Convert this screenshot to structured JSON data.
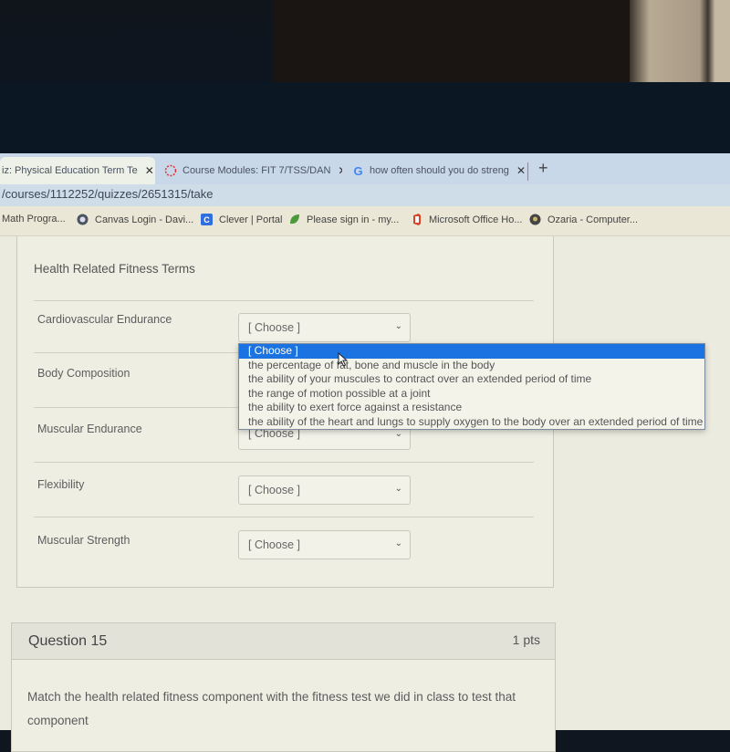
{
  "browser": {
    "tabs": [
      {
        "title": "iz: Physical Education Term Te",
        "icon": "canvas-quiz-icon",
        "active": true
      },
      {
        "title": "Course Modules: FIT 7/TSS/DAN",
        "icon": "canvas-logo-icon",
        "active": false
      },
      {
        "title": "how often should you do streng",
        "icon": "google-icon",
        "active": false
      }
    ],
    "close_glyph": "✕",
    "new_tab_glyph": "+",
    "url": "/courses/1112252/quizzes/2651315/take",
    "bookmarks": [
      {
        "label": "Math Progra...",
        "icon": "none"
      },
      {
        "label": "Canvas Login - Davi...",
        "icon": "canvas-icon"
      },
      {
        "label": "Clever | Portal",
        "icon": "clever-icon",
        "icon_text": "C"
      },
      {
        "label": "Please sign in - my...",
        "icon": "leaf-icon"
      },
      {
        "label": "Microsoft Office Ho...",
        "icon": "office-icon"
      },
      {
        "label": "Ozaria - Computer...",
        "icon": "ozaria-icon"
      }
    ]
  },
  "question14": {
    "title": "Health Related Fitness Terms",
    "rows": [
      {
        "term": "Cardiovascular Endurance",
        "selected": "[ Choose ]"
      },
      {
        "term": "Body Composition",
        "selected": "[ Choose ]"
      },
      {
        "term": "Muscular Endurance",
        "selected": "[ Choose ]"
      },
      {
        "term": "Flexibility",
        "selected": "[ Choose ]"
      },
      {
        "term": "Muscular Strength",
        "selected": "[ Choose ]"
      }
    ],
    "chevron_glyph": "⌄",
    "dropdown_options": [
      "[ Choose ]",
      "the percentage of fat, bone and muscle in the body",
      "the ability of your muscules to contract over an extended period of time",
      "the range of motion possible at a joint",
      "the ability to exert force against a resistance",
      "the ability of the heart and lungs to supply oxygen to the body over an extended period of time"
    ],
    "highlighted_option_index": 0
  },
  "question15": {
    "title": "Question 15",
    "points": "1 pts",
    "text": "Match the health related fitness component with the fitness test we did in class to test that component"
  },
  "colors": {
    "highlight": "#1a73e0",
    "page_bg": "#ecebdf",
    "tabstrip": "#c9d8e8"
  }
}
